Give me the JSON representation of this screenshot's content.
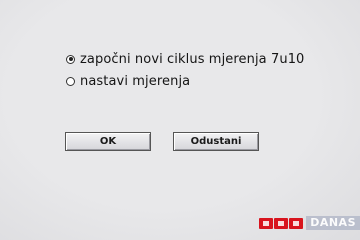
{
  "dialog": {
    "options": [
      {
        "label": "započni novi ciklus mjerenja 7u10",
        "selected": true
      },
      {
        "label": "nastavi mjerenja",
        "selected": false
      }
    ],
    "ok_label": "OK",
    "cancel_label": "Odustani"
  },
  "watermark": {
    "brand": "RTL",
    "text": "DANAS",
    "colors": {
      "brand": "#d8141e",
      "text_bg": "#b7bccb"
    }
  }
}
